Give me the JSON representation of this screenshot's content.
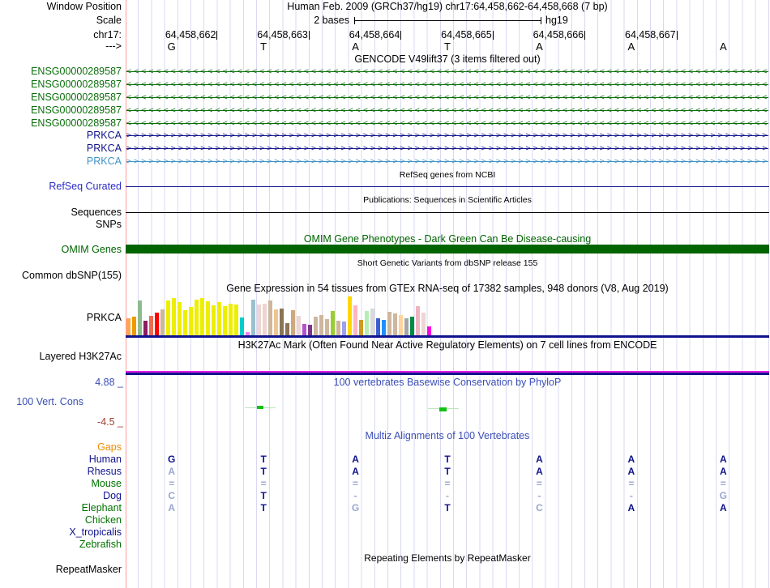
{
  "labels": {
    "window_position": "Window Position",
    "scale": "Scale",
    "chrom": "chr17:",
    "strand": "--->",
    "refseq_curated": "RefSeq Curated",
    "sequences": "Sequences",
    "snps": "SNPs",
    "omim_genes": "OMIM Genes",
    "common_dbsnp": "Common dbSNP(155)",
    "gtex_gene": "PRKCA",
    "layered_h3k27ac": "Layered H3K27Ac",
    "cons_max": "4.88 _",
    "cons_track": "100 Vert. Cons",
    "cons_min": "-4.5 _",
    "repeatmasker": "RepeatMasker"
  },
  "headers": {
    "assembly_position": "Human Feb. 2009 (GRCh37/hg19)   chr17:64,458,662-64,458,668 (7 bp)",
    "gencode": "GENCODE V49lift37 (3 items filtered out)",
    "refseq": "RefSeq genes from NCBI",
    "publications": "Publications: Sequences in Scientific Articles",
    "omim": "OMIM Gene Phenotypes - Dark Green Can Be Disease-causing",
    "dbsnp": "Short Genetic Variants from dbSNP release 155",
    "gtex": "Gene Expression in 54 tissues from GTEx RNA-seq of 17382 samples, 948 donors (V8, Aug 2019)",
    "h3k27ac": "H3K27Ac Mark (Often Found Near Active Regulatory Elements) on 7 cell lines from ENCODE",
    "phylop": "100 vertebrates Basewise Conservation by PhyloP",
    "multiz": "Multiz Alignments of 100 Vertebrates",
    "repeatmasker": "Repeating Elements by RepeatMasker"
  },
  "scale": {
    "value": "2 bases",
    "assembly": "hg19"
  },
  "ruler": {
    "positions": [
      "64,458,662",
      "64,458,663",
      "64,458,664",
      "64,458,665",
      "64,458,666",
      "64,458,667"
    ],
    "bases": [
      "G",
      "T",
      "A",
      "T",
      "A",
      "A",
      "A"
    ]
  },
  "gencode": {
    "rows": [
      {
        "label": "ENSG00000289587",
        "color": "green",
        "dir": "<"
      },
      {
        "label": "ENSG00000289587",
        "color": "green",
        "dir": "<"
      },
      {
        "label": "ENSG00000289587",
        "color": "green",
        "dir": "<"
      },
      {
        "label": "ENSG00000289587",
        "color": "green",
        "dir": "<"
      },
      {
        "label": "ENSG00000289587",
        "color": "green",
        "dir": "<"
      },
      {
        "label": "PRKCA",
        "color": "navy",
        "dir": ">"
      },
      {
        "label": "PRKCA",
        "color": "navy",
        "dir": ">"
      },
      {
        "label": "PRKCA",
        "color": "lightblue",
        "dir": ">"
      }
    ]
  },
  "gtex": {
    "gene": "PRKCA",
    "bars": [
      {
        "c": "#FFA54F",
        "h": 0.42
      },
      {
        "c": "#EE9A00",
        "h": 0.45
      },
      {
        "c": "#8FBC8F",
        "h": 0.85
      },
      {
        "c": "#8B1C62",
        "h": 0.35
      },
      {
        "c": "#EE6A50",
        "h": 0.48
      },
      {
        "c": "#FF0000",
        "h": 0.55
      },
      {
        "c": "#CDB79E",
        "h": 0.64
      },
      {
        "c": "#EEEE00",
        "h": 0.86
      },
      {
        "c": "#EEEE00",
        "h": 0.92
      },
      {
        "c": "#EEEE00",
        "h": 0.82
      },
      {
        "c": "#EEEE00",
        "h": 0.62
      },
      {
        "c": "#EEEE00",
        "h": 0.7
      },
      {
        "c": "#EEEE00",
        "h": 0.88
      },
      {
        "c": "#EEEE00",
        "h": 0.92
      },
      {
        "c": "#EEEE00",
        "h": 0.84
      },
      {
        "c": "#EEEE00",
        "h": 0.74
      },
      {
        "c": "#EEEE00",
        "h": 0.82
      },
      {
        "c": "#EEEE00",
        "h": 0.72
      },
      {
        "c": "#EEEE00",
        "h": 0.78
      },
      {
        "c": "#EEEE00",
        "h": 0.76
      },
      {
        "c": "#00CDCD",
        "h": 0.44
      },
      {
        "c": "#EE82EE",
        "h": 0.08
      },
      {
        "c": "#9AC0CD",
        "h": 0.88
      },
      {
        "c": "#EED5D2",
        "h": 0.76
      },
      {
        "c": "#EED5D2",
        "h": 0.78
      },
      {
        "c": "#CDB79E",
        "h": 0.86
      },
      {
        "c": "#EEC591",
        "h": 0.64
      },
      {
        "c": "#8B7355",
        "h": 0.66
      },
      {
        "c": "#8B7355",
        "h": 0.3
      },
      {
        "c": "#CDAA7D",
        "h": 0.62
      },
      {
        "c": "#EED5D2",
        "h": 0.48
      },
      {
        "c": "#B452CD",
        "h": 0.28
      },
      {
        "c": "#7A378B",
        "h": 0.26
      },
      {
        "c": "#CDB79E",
        "h": 0.46
      },
      {
        "c": "#CDB79E",
        "h": 0.5
      },
      {
        "c": "#CDB79E",
        "h": 0.4
      },
      {
        "c": "#9ACD32",
        "h": 0.6
      },
      {
        "c": "#CDB79E",
        "h": 0.35
      },
      {
        "c": "#9F9FEE",
        "h": 0.33
      },
      {
        "c": "#FFD700",
        "h": 0.95
      },
      {
        "c": "#FFB6C1",
        "h": 0.74
      },
      {
        "c": "#CD9B1D",
        "h": 0.38
      },
      {
        "c": "#B4EEB4",
        "h": 0.6
      },
      {
        "c": "#D9D9D9",
        "h": 0.65
      },
      {
        "c": "#3A5FCD",
        "h": 0.42
      },
      {
        "c": "#1E90FF",
        "h": 0.38
      },
      {
        "c": "#CDB79E",
        "h": 0.58
      },
      {
        "c": "#CDB79E",
        "h": 0.54
      },
      {
        "c": "#FFD39B",
        "h": 0.5
      },
      {
        "c": "#A6A6A6",
        "h": 0.42
      },
      {
        "c": "#008B45",
        "h": 0.46
      },
      {
        "c": "#EEB4C0",
        "h": 0.72
      },
      {
        "c": "#EED5D2",
        "h": 0.55
      },
      {
        "c": "#FF00E6",
        "h": 0.22
      }
    ]
  },
  "multiz": {
    "rows": [
      {
        "label": "Gaps",
        "color": "orange",
        "cells": []
      },
      {
        "label": "Human",
        "color": "navy",
        "cells": [
          [
            "G",
            "d"
          ],
          [
            "T",
            "d"
          ],
          [
            "A",
            "d"
          ],
          [
            "T",
            "d"
          ],
          [
            "A",
            "d"
          ],
          [
            "A",
            "d"
          ],
          [
            "A",
            "d"
          ]
        ]
      },
      {
        "label": "Rhesus",
        "color": "navy",
        "cells": [
          [
            "A",
            "l"
          ],
          [
            "T",
            "d"
          ],
          [
            "A",
            "d"
          ],
          [
            "T",
            "d"
          ],
          [
            "A",
            "d"
          ],
          [
            "A",
            "d"
          ],
          [
            "A",
            "d"
          ]
        ]
      },
      {
        "label": "Mouse",
        "color": "green",
        "cells": [
          [
            "=",
            "l"
          ],
          [
            "=",
            "l"
          ],
          [
            "=",
            "l"
          ],
          [
            "=",
            "l"
          ],
          [
            "=",
            "l"
          ],
          [
            "=",
            "l"
          ],
          [
            "=",
            "l"
          ]
        ]
      },
      {
        "label": "Dog",
        "color": "navy",
        "cells": [
          [
            "C",
            "l"
          ],
          [
            "T",
            "d"
          ],
          [
            "-",
            "l"
          ],
          [
            "-",
            "l"
          ],
          [
            "-",
            "l"
          ],
          [
            "-",
            "l"
          ],
          [
            "G",
            "l"
          ]
        ]
      },
      {
        "label": "Elephant",
        "color": "green",
        "cells": [
          [
            "A",
            "l"
          ],
          [
            "T",
            "d"
          ],
          [
            "G",
            "l"
          ],
          [
            "T",
            "d"
          ],
          [
            "C",
            "l"
          ],
          [
            "A",
            "d"
          ],
          [
            "A",
            "d"
          ]
        ]
      },
      {
        "label": "Chicken",
        "color": "green",
        "cells": []
      },
      {
        "label": "X_tropicalis",
        "color": "navy",
        "cells": []
      },
      {
        "label": "Zebrafish",
        "color": "green",
        "cells": []
      }
    ]
  },
  "colors": {
    "green": "#0B6E0B",
    "navy": "#10138C",
    "lightblue": "#3E93C6",
    "refseq_blue": "#2D2DC8",
    "omim_green": "#006400",
    "blue_header": "#3A4EB5",
    "neg_value": "#9E4030",
    "orange": "#ED8C00",
    "species_green": "#007200",
    "magenta": "#E81BE8",
    "grid": "#D9D9F3",
    "red_line": "#FF9C9C",
    "dark_letter": "#10138C",
    "light_letter": "#9AA6D0",
    "pale_green": "#BCE4BC",
    "bright_green": "#12C212"
  }
}
